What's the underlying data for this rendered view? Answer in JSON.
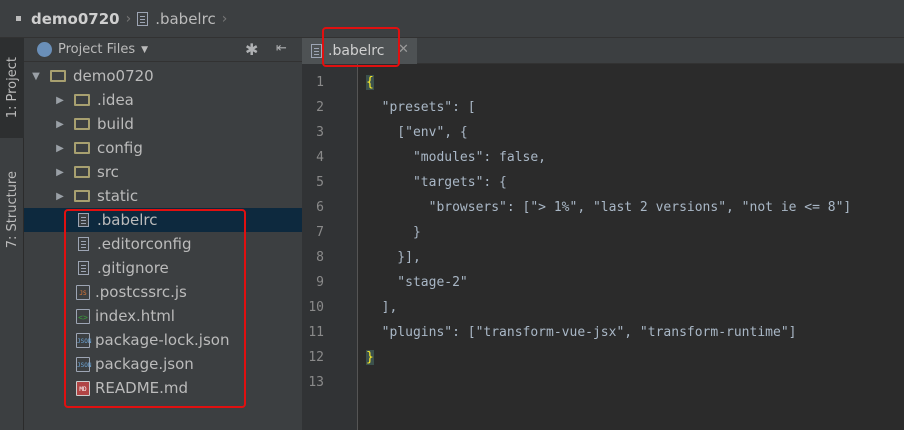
{
  "navbar": {
    "project": "demo0720",
    "file": ".babelrc"
  },
  "toolstrip": {
    "project_tab": "1: Project",
    "structure_tab": "7: Structure"
  },
  "panel": {
    "title": "Project Files"
  },
  "tree": [
    {
      "name": "demo0720",
      "kind": "folder",
      "expanded": true
    },
    {
      "name": ".idea",
      "kind": "folder"
    },
    {
      "name": "build",
      "kind": "folder"
    },
    {
      "name": "config",
      "kind": "folder"
    },
    {
      "name": "src",
      "kind": "folder"
    },
    {
      "name": "static",
      "kind": "folder"
    },
    {
      "name": ".babelrc",
      "kind": "text",
      "selected": true
    },
    {
      "name": ".editorconfig",
      "kind": "text"
    },
    {
      "name": ".gitignore",
      "kind": "text"
    },
    {
      "name": ".postcssrc.js",
      "kind": "js",
      "badge": "JS"
    },
    {
      "name": "index.html",
      "kind": "html",
      "badge": "<>"
    },
    {
      "name": "package-lock.json",
      "kind": "json",
      "badge": "JSON"
    },
    {
      "name": "package.json",
      "kind": "json",
      "badge": "JSON"
    },
    {
      "name": "README.md",
      "kind": "md",
      "badge": "MD"
    }
  ],
  "editor": {
    "tab_label": ".babelrc",
    "line_numbers": [
      "1",
      "2",
      "3",
      "4",
      "5",
      "6",
      "7",
      "8",
      "9",
      "10",
      "11",
      "12",
      "13"
    ],
    "lines": [
      "{",
      "  \"presets\": [",
      "    [\"env\", {",
      "      \"modules\": false,",
      "      \"targets\": {",
      "        \"browsers\": [\"> 1%\", \"last 2 versions\", \"not ie <= 8\"]",
      "      }",
      "    }],",
      "    \"stage-2\"",
      "  ],",
      "  \"plugins\": [\"transform-vue-jsx\", \"transform-runtime\"]",
      "}",
      ""
    ]
  }
}
